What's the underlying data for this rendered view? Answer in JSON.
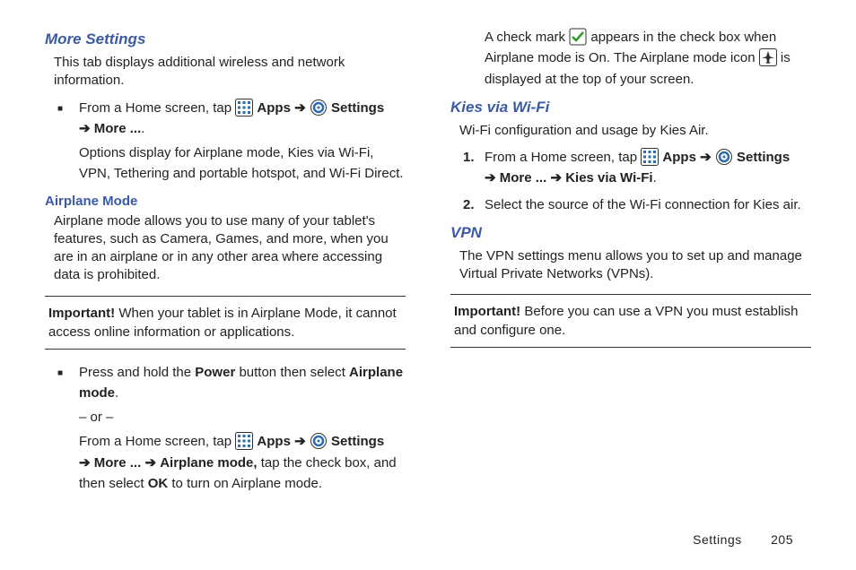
{
  "left": {
    "h1": "More Settings",
    "p1": "This tab displays additional wireless and network information.",
    "b1a": "From a Home screen, tap ",
    "apps": "Apps",
    "arrow": "➔",
    "settings": "Settings",
    "more": "More ...",
    "b1b": "Options display for Airplane mode, Kies via Wi-Fi, VPN, Tethering and portable hotspot, and Wi-Fi Direct.",
    "h2": "Airplane Mode",
    "p2": "Airplane mode allows you to use many of your tablet's features, such as Camera, Games, and more, when you are in an airplane or in any other area where accessing data is prohibited.",
    "imp_lead": "Important!",
    "imp_body": " When your tablet is in Airplane Mode, it cannot access online information or applications.",
    "b2a_pre": "Press and hold the ",
    "power": "Power",
    "b2a_mid": " button then select ",
    "airplane_mode": "Airplane mode",
    "or": "– or –",
    "b2b_pre": "From a Home screen, tap ",
    "b2b_mid": " tap the check box, and then select ",
    "ok": "OK",
    "b2b_end": " to turn on Airplane mode.",
    "airplane_mode_comma": "Airplane mode,"
  },
  "right": {
    "top_a": "A check mark ",
    "top_b": " appears in the check box when Airplane mode is On. The Airplane mode icon ",
    "top_c": " is displayed at the top of your screen.",
    "h3": "Kies via Wi-Fi",
    "p3": "Wi-Fi configuration and usage by Kies Air.",
    "kies": "Kies via Wi-Fi",
    "n1_pre": "From a Home screen, tap ",
    "n2": "Select the source of the Wi-Fi connection for Kies air.",
    "h4": "VPN",
    "p4": "The VPN settings menu allows you to set up and manage Virtual Private Networks (VPNs).",
    "imp_lead": "Important!",
    "imp_body": " Before you can use a VPN you must establish and configure one."
  },
  "footer": {
    "section": "Settings",
    "page": "205"
  },
  "numbers": {
    "one": "1.",
    "two": "2."
  },
  "period": "."
}
